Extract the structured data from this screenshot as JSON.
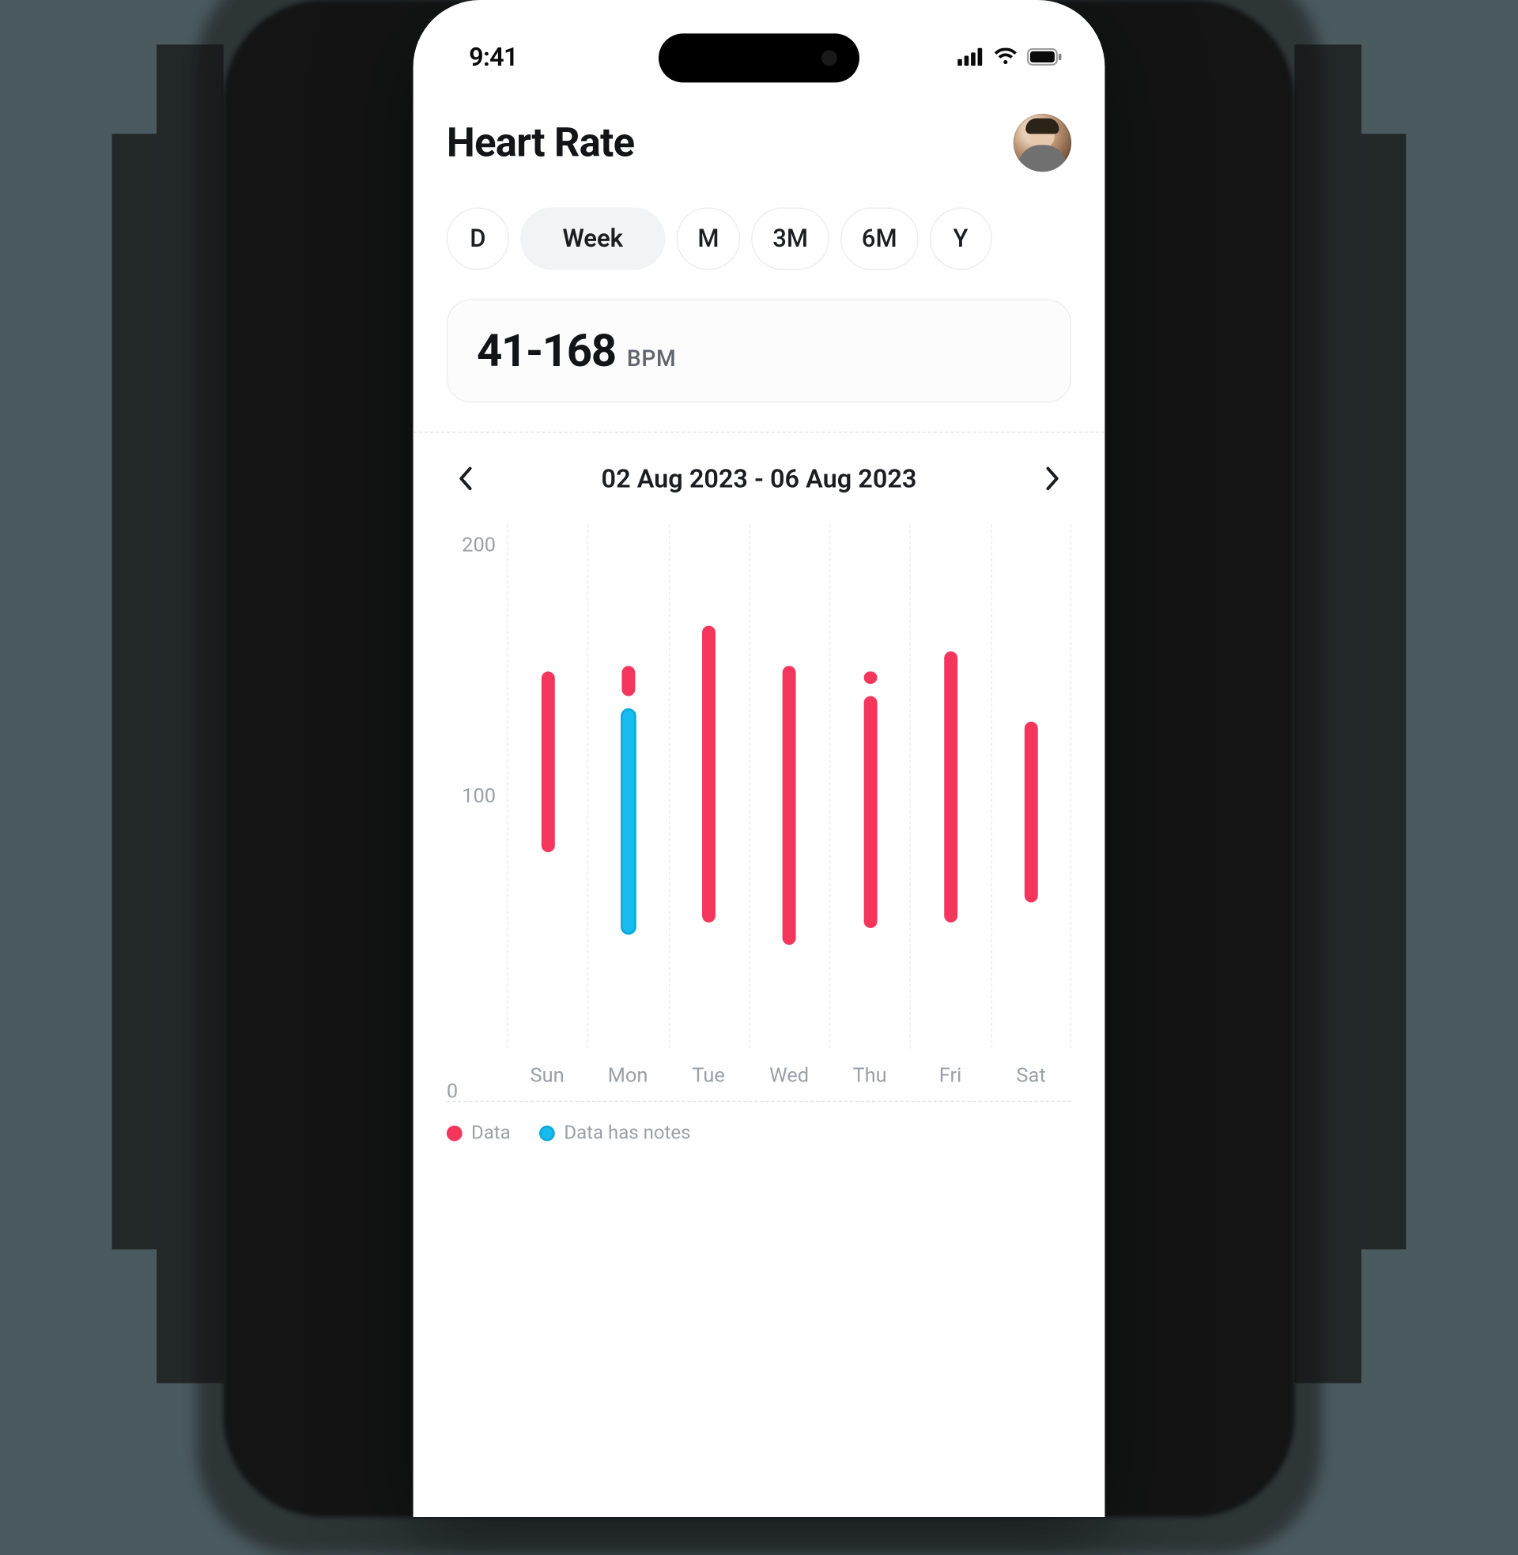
{
  "status": {
    "time": "9:41"
  },
  "header": {
    "title": "Heart Rate"
  },
  "range_tabs": {
    "items": [
      {
        "label": "D",
        "active": false
      },
      {
        "label": "Week",
        "active": true
      },
      {
        "label": "M",
        "active": false
      },
      {
        "label": "3M",
        "active": false
      },
      {
        "label": "6M",
        "active": false
      },
      {
        "label": "Y",
        "active": false
      }
    ]
  },
  "summary": {
    "value": "41-168",
    "unit": "BPM"
  },
  "date_nav": {
    "range": "02 Aug 2023 - 06 Aug 2023"
  },
  "chart": {
    "y_ticks": {
      "t200": "200",
      "t100": "100",
      "t0": "0"
    }
  },
  "legend": {
    "data": "Data",
    "notes": "Data has notes"
  },
  "colors": {
    "data": "#f5365c",
    "notes": "#18bdf0"
  },
  "chart_data": {
    "type": "range-bar",
    "ylabel": "BPM",
    "ylim": [
      0,
      200
    ],
    "y_ticks": [
      0,
      100,
      200
    ],
    "categories": [
      "Sun",
      "Mon",
      "Tue",
      "Wed",
      "Thu",
      "Fri",
      "Sat"
    ],
    "series": [
      {
        "name": "Data",
        "color": "#f5365c",
        "ranges": [
          {
            "day": "Sun",
            "low": 78,
            "high": 150
          },
          {
            "day": "Mon",
            "low": 140,
            "high": 152,
            "detached_dot": true
          },
          {
            "day": "Tue",
            "low": 50,
            "high": 168
          },
          {
            "day": "Wed",
            "low": 41,
            "high": 152
          },
          {
            "day": "Thu",
            "low": 48,
            "high": 140,
            "detached_dot_high": 150
          },
          {
            "day": "Fri",
            "low": 50,
            "high": 158
          },
          {
            "day": "Sat",
            "low": 58,
            "high": 130
          }
        ]
      },
      {
        "name": "Data has notes",
        "color": "#18bdf0",
        "ranges": [
          {
            "day": "Mon",
            "low": 45,
            "high": 135
          }
        ]
      }
    ]
  }
}
